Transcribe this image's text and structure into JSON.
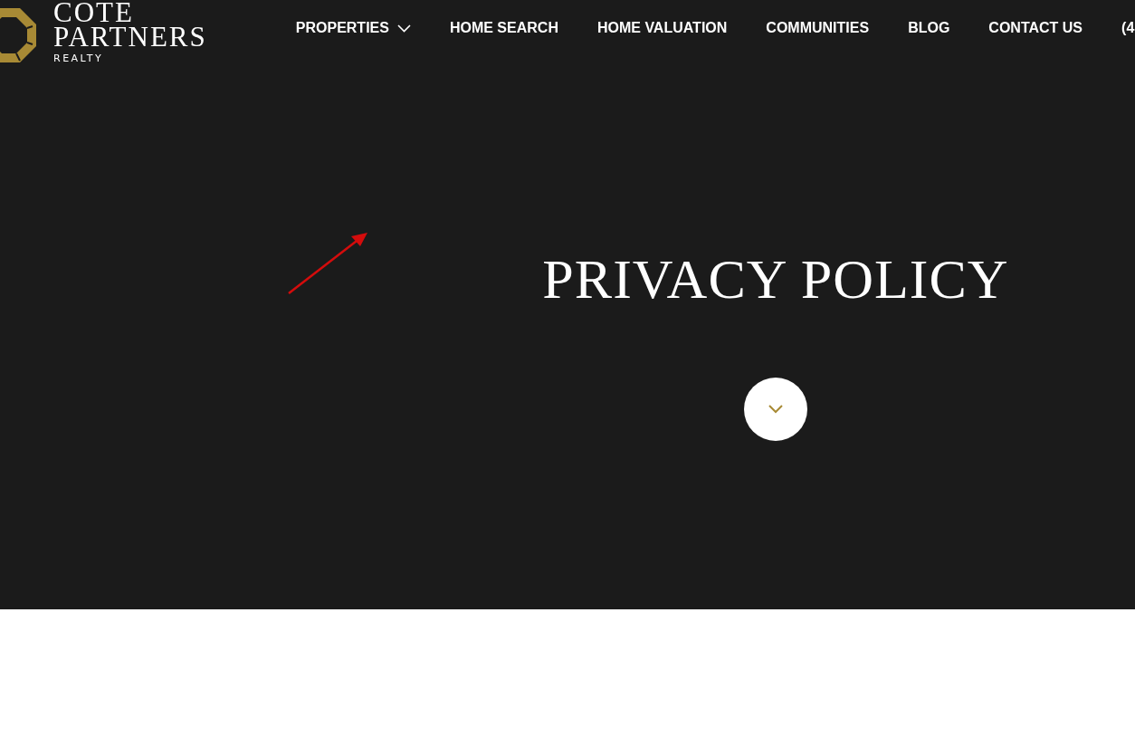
{
  "logo": {
    "line_1": "COTE",
    "line_2": "PARTNERS",
    "line_3": "REALTY"
  },
  "nav": [
    {
      "label": "PROPERTIES",
      "kind": "dropdown"
    },
    {
      "label": "HOME SEARCH",
      "kind": "link"
    },
    {
      "label": "HOME VALUATION",
      "kind": "link"
    },
    {
      "label": "COMMUNITIES",
      "kind": "link"
    },
    {
      "label": "BLOG",
      "kind": "link"
    },
    {
      "label": "CONTACT US",
      "kind": "link"
    },
    {
      "label": "(4",
      "kind": "link"
    }
  ],
  "hero": {
    "title": "PRIVACY POLICY"
  }
}
